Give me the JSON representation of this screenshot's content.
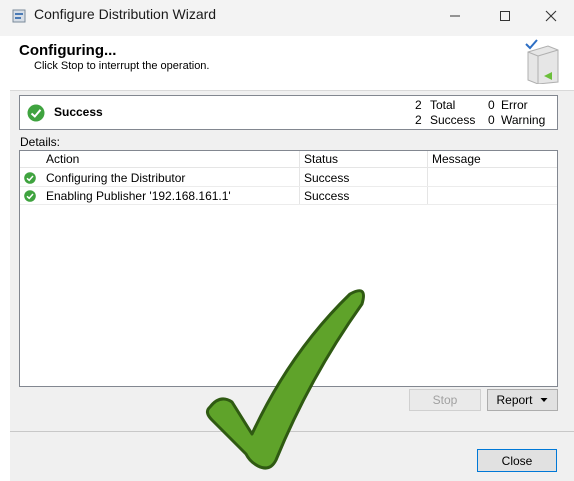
{
  "window": {
    "title": "Configure Distribution Wizard"
  },
  "header": {
    "title": "Configuring...",
    "subtitle": "Click Stop to interrupt the operation."
  },
  "summary": {
    "status": "Success",
    "total_count": "2",
    "total_label": "Total",
    "success_count": "2",
    "success_label": "Success",
    "error_count": "0",
    "error_label": "Error",
    "warning_count": "0",
    "warning_label": "Warning"
  },
  "details": {
    "label": "Details:",
    "columns": [
      "Action",
      "Status",
      "Message"
    ],
    "rows": [
      {
        "action": "Configuring the Distributor",
        "status": "Success",
        "message": ""
      },
      {
        "action": "Enabling Publisher '192.168.161.1'",
        "status": "Success",
        "message": ""
      }
    ]
  },
  "buttons": {
    "stop": "Stop",
    "report": "Report",
    "close": "Close"
  },
  "colors": {
    "success_green": "#3fa33f",
    "overlay_check": "#5fa32a",
    "accent_border": "#0078d7"
  }
}
